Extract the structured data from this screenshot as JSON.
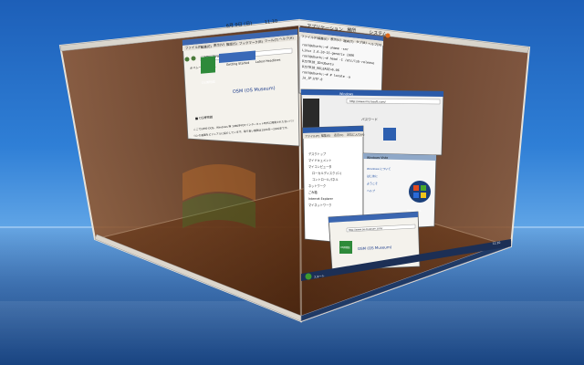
{
  "top_panel": {
    "date": "6月 9日 (日)",
    "clock": "11:10",
    "applications_label": "アプリケーション",
    "places_label": "場所",
    "system_label": "システム"
  },
  "browser_window": {
    "menu": [
      "ファイル(F)",
      "編集(E)",
      "表示(V)",
      "履歴(S)",
      "ブックマーク(B)",
      "ツール(T)",
      "ヘルプ(H)"
    ],
    "url": "http://www.os-museum.com/",
    "tabs": [
      "オペレーティング...",
      "Getting Started",
      "Latest Headlines"
    ],
    "logo_text": "OSM (OS Museum)",
    "logo_small": "OS博物館",
    "section_heading": "■ OS博物館",
    "body_line1": "ここではMS-DOS、Windows 等 1980年代のインターネット時代に開発された古いパソ",
    "body_line2": "コンの画面をビジュアルに紹介しています。取り扱い期間は1994年〜2000年です。"
  },
  "terminal_window": {
    "menu": [
      "ファイル(F)",
      "編集(E)",
      "表示(V)",
      "端末(T)",
      "タブ(B)",
      "ヘルプ(H)"
    ],
    "lines": [
      "root@ubuntu:~# uname -snr",
      "Linux 2.6.20-15-generic i686",
      "root@ubuntu:~# head -1 /etc/lsb-release",
      "DISTRIB_ID=Ubuntu",
      "DISTRIB_RELEASE=6.06",
      "root@ubuntu:~# # locale -a",
      "ja_JP.UTF-8"
    ]
  },
  "gadget_window": {
    "title": "Windows",
    "address": "http://www.microsoft.com/",
    "label": "パスワード"
  },
  "explorer_window": {
    "menu": [
      "ファイル(F)",
      "編集(E)",
      "表示(V)",
      "お気に入り(A)",
      "ツール(T)",
      "ヘルプ(H)"
    ],
    "tree": [
      "デスクトップ",
      "マイドキュメント",
      "マイコンピュータ",
      "ローカルディスク (C:)",
      "コントロールパネル",
      "ネットワーク",
      "ごみ箱",
      "Internet Explorer",
      "マイネットワーク"
    ]
  },
  "vista_window": {
    "title": "Windows Vista",
    "links": [
      "Windows について",
      "はじめに",
      "ようこそ",
      "ヘルプ"
    ],
    "logo": "Windows"
  },
  "small_browser": {
    "url": "http://www.os-museum.com/",
    "logo_text": "OSM (OS Museum)",
    "logo_small": "OS博物館"
  },
  "taskbar": {
    "start_label": "スタート",
    "time": "11:10"
  },
  "colors": {
    "desktop_blue": "#2f7fd6",
    "cube_face": "#7a3d14",
    "panel_gray": "#d4d0c8",
    "titlebar_blue": "#1a4aa0"
  }
}
